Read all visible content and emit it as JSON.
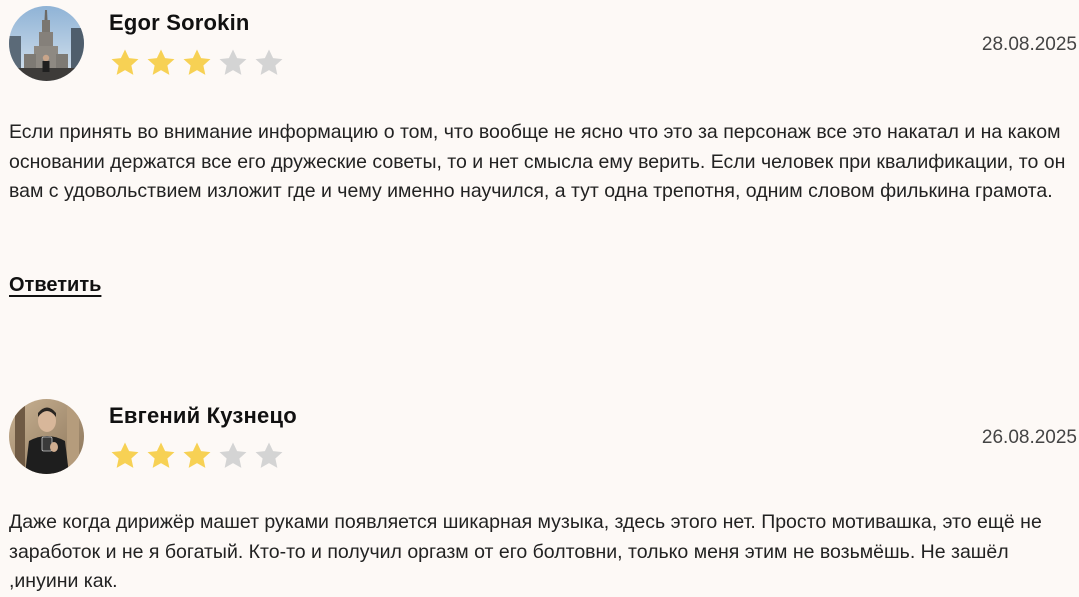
{
  "reviews": [
    {
      "author": "Egor Sorokin",
      "date": "28.08.2025",
      "rating": 3,
      "max_rating": 5,
      "text": "Если принять во внимание информацию о том, что вообще не ясно что это за персонаж все это накатал и на каком основании держатся все его дружеские советы, то и нет смысла ему верить. Если человек при квалификации, то он вам с удовольствием изложит где и чему именно научился, а тут одна трепотня, одним словом филькина грамота.",
      "reply_label": "Ответить",
      "avatar_icon": "user-photo-avatar"
    },
    {
      "author": "Евгений Кузнецо",
      "date": "26.08.2025",
      "rating": 3,
      "max_rating": 5,
      "text": "Даже когда дирижёр машет руками появляется шикарная музыка, здесь этого нет. Просто мотивашка, это ещё не заработок и не я богатый. Кто-то и получил оргазм от его болтовни, только меня этим не возьмёшь. Не зашёл ,инуини как.",
      "avatar_icon": "user-photo-avatar"
    }
  ],
  "colors": {
    "background": "#fdf9f6",
    "star_filled": "#f7d154",
    "star_empty": "#d4d4d4"
  }
}
